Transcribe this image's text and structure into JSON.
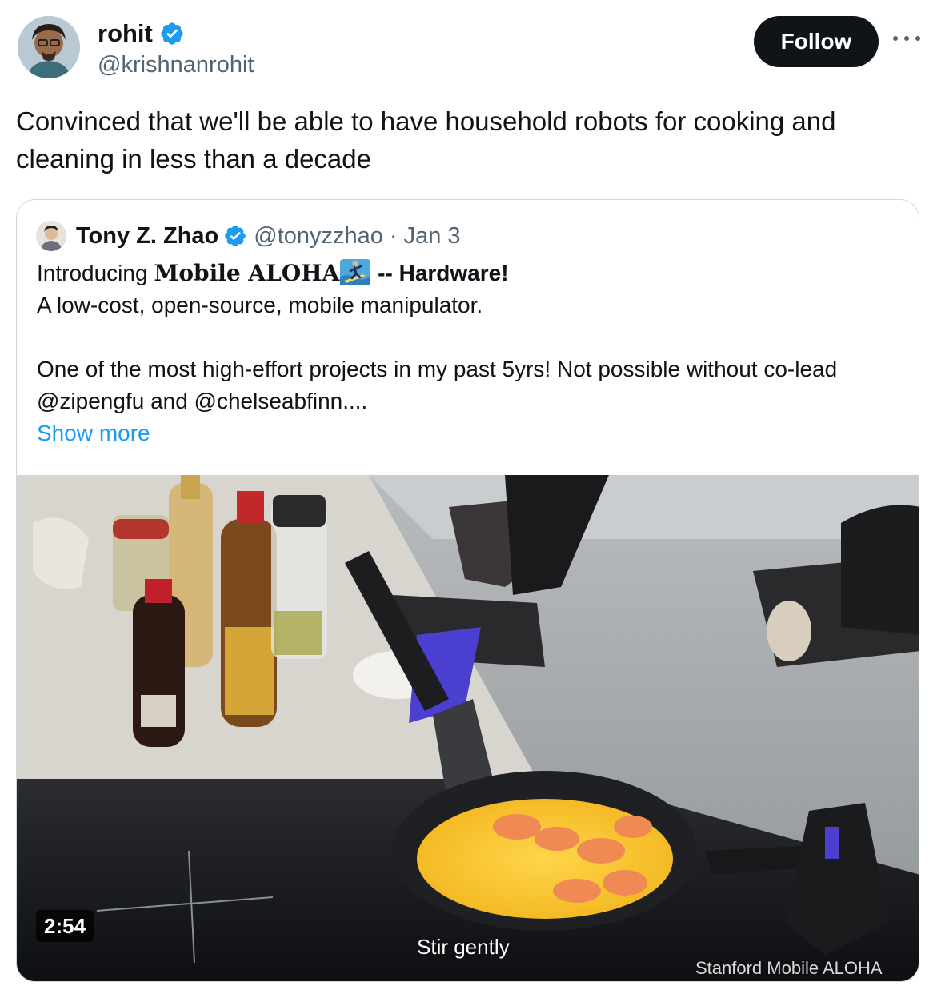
{
  "author": {
    "display_name": "rohit",
    "handle": "@krishnanrohit",
    "verified": true
  },
  "follow_label": "Follow",
  "tweet_text": "Convinced that we'll be able to have household robots for cooking and cleaning in less than a decade",
  "quoted": {
    "display_name": "Tony Z. Zhao",
    "handle": "@tonyzzhao",
    "separator": "·",
    "date": "Jan 3",
    "intro": "Introducing ",
    "product": "Mobile ALOHA",
    "emoji": "surfer-emoji",
    "hardware": " -- Hardware!",
    "line2": "A low-cost, open-source, mobile manipulator.",
    "line3": "One of the most high-effort projects in my past 5yrs! Not possible without co-lead @zipengfu and @chelseabfinn....",
    "show_more": "Show more",
    "video": {
      "duration": "2:54",
      "caption": "Stir gently",
      "watermark": "Stanford Mobile ALOHA"
    }
  },
  "colors": {
    "accent": "#1d9bf0",
    "text": "#0f1419",
    "secondary": "#536471",
    "border": "#cfd9de",
    "follow_bg": "#0f1419"
  },
  "icons": [
    "verified-badge-icon",
    "more-options-icon",
    "surfer-emoji"
  ]
}
